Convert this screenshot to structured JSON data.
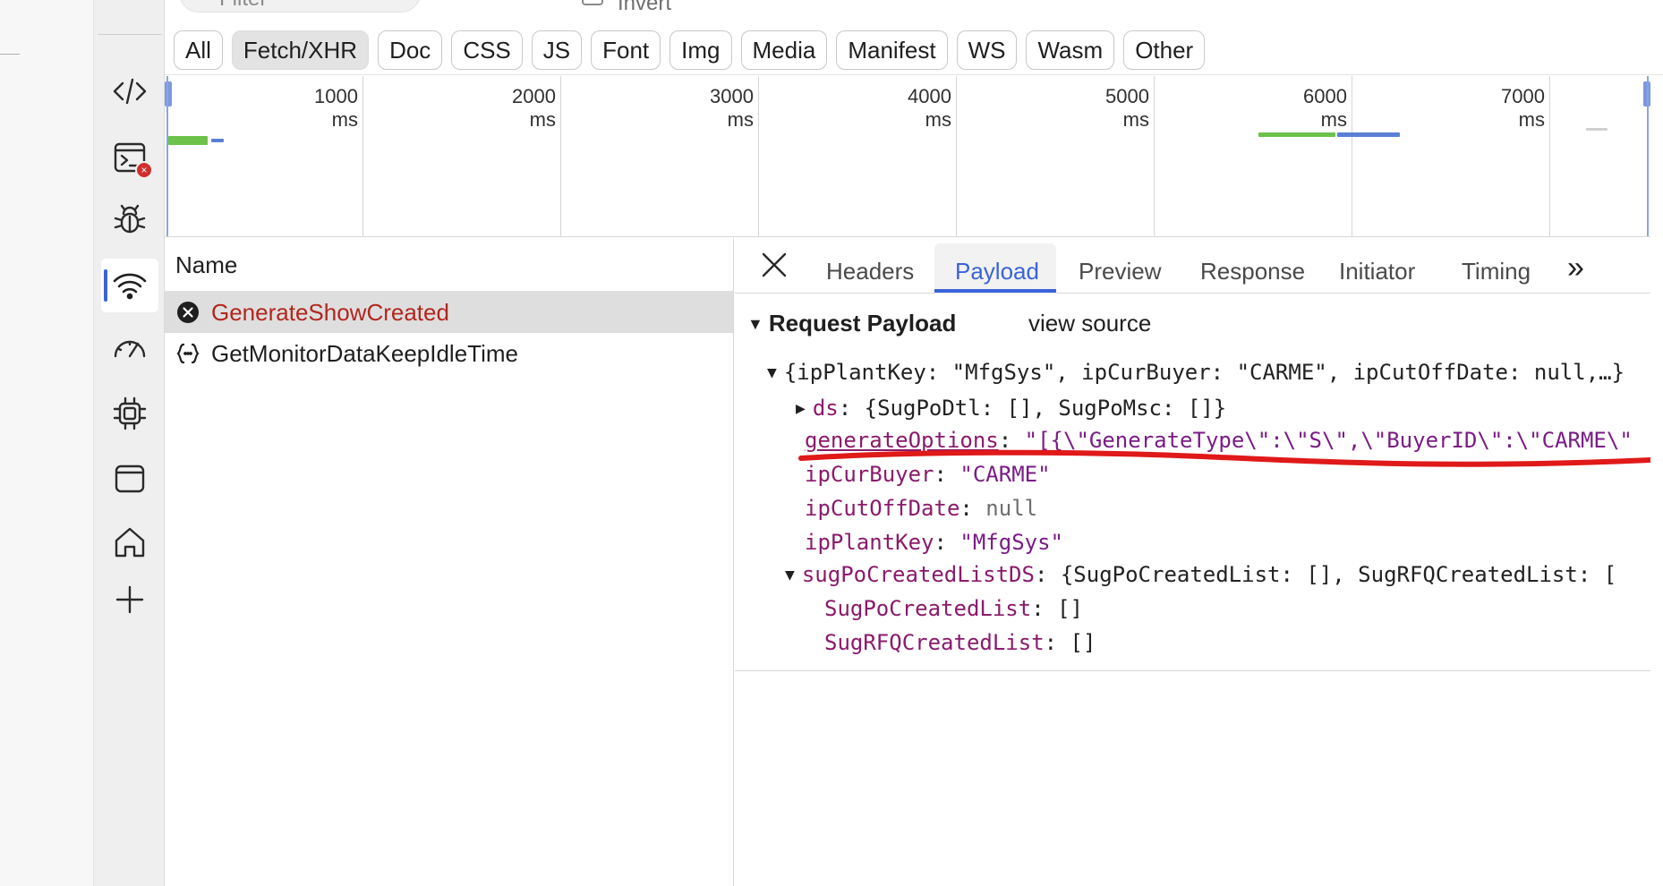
{
  "filterbar": {
    "filter_placeholder": "Filter",
    "invert_label": "Invert",
    "chips": [
      "All",
      "Fetch/XHR",
      "Doc",
      "CSS",
      "JS",
      "Font",
      "Img",
      "Media",
      "Manifest",
      "WS",
      "Wasm",
      "Other"
    ],
    "selected_chip": "Fetch/XHR"
  },
  "activity_bar": {
    "items": [
      "code-icon",
      "console-icon",
      "bug-icon",
      "network-wifi-icon",
      "performance-gauge-icon",
      "memory-chip-icon",
      "application-window-icon",
      "home-icon",
      "add-icon"
    ],
    "active": "network-wifi-icon",
    "console_badge": "×"
  },
  "timeline": {
    "labels": [
      "1000 ms",
      "2000 ms",
      "3000 ms",
      "4000 ms",
      "5000 ms",
      "6000 ms",
      "7000 ms"
    ]
  },
  "request_list": {
    "header": "Name",
    "rows": [
      {
        "name": "GenerateShowCreated",
        "status": "error",
        "icon": "error-circle-icon"
      },
      {
        "name": "GetMonitorDataKeepIdleTime",
        "status": "ok",
        "icon": "fetch-braces-icon"
      }
    ]
  },
  "detail": {
    "tabs": [
      "Headers",
      "Payload",
      "Preview",
      "Response",
      "Initiator",
      "Timing"
    ],
    "active_tab": "Payload",
    "more_tabs": "»",
    "payload": {
      "section_title": "Request Payload",
      "view_source": "view source",
      "root_summary": "{ipPlantKey: \"MfgSys\", ipCurBuyer: \"CARME\", ipCutOffDate: null,…}",
      "ds_key": "ds",
      "ds_summary": "{SugPoDtl: [], SugPoMsc: []}",
      "generate_key": "generateOptions",
      "generate_value": "\"[{\\\"GenerateType\\\":\\\"S\\\",\\\"BuyerID\\\":\\\"CARME\\\"",
      "buyer_key": "ipCurBuyer",
      "buyer_value": "\"CARME\"",
      "cutoff_key": "ipCutOffDate",
      "cutoff_value": "null",
      "plant_key": "ipPlantKey",
      "plant_value": "\"MfgSys\"",
      "sug_key": "sugPoCreatedListDS",
      "sug_summary": "{SugPoCreatedList: [], SugRFQCreatedList: [",
      "sugpo_key": "SugPoCreatedList",
      "sugpo_value": "[]",
      "sugrfq_key": "SugRFQCreatedList",
      "sugrfq_value": "[]"
    }
  },
  "colors": {
    "accent": "#3a63d8",
    "error": "#b3261e",
    "annotation": "#e01919",
    "bar_green": "#6cc24a",
    "bar_blue": "#5b7fd6"
  }
}
